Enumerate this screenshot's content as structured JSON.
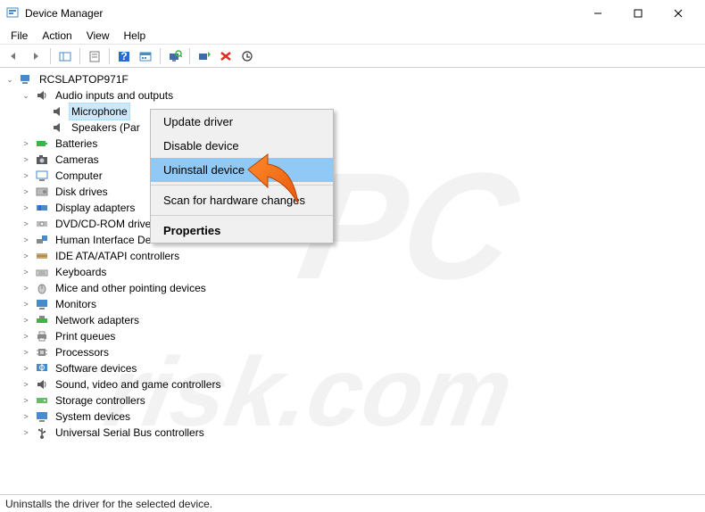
{
  "window": {
    "title": "Device Manager"
  },
  "menubar": {
    "file": "File",
    "action": "Action",
    "view": "View",
    "help": "Help"
  },
  "tree": {
    "root": "RCSLAPTOP971F",
    "audio": "Audio inputs and outputs",
    "microphone": "Microphone",
    "speakers": "Speakers (Par",
    "batteries": "Batteries",
    "cameras": "Cameras",
    "computer": "Computer",
    "diskDrives": "Disk drives",
    "displayAdapters": "Display adapters",
    "dvd": "DVD/CD-ROM drives",
    "hid": "Human Interface Devices",
    "ide": "IDE ATA/ATAPI controllers",
    "keyboards": "Keyboards",
    "mice": "Mice and other pointing devices",
    "monitors": "Monitors",
    "network": "Network adapters",
    "printQueues": "Print queues",
    "processors": "Processors",
    "software": "Software devices",
    "sound": "Sound, video and game controllers",
    "storage": "Storage controllers",
    "system": "System devices",
    "usb": "Universal Serial Bus controllers"
  },
  "contextMenu": {
    "update": "Update driver",
    "disable": "Disable device",
    "uninstall": "Uninstall device",
    "scan": "Scan for hardware changes",
    "properties": "Properties"
  },
  "statusbar": {
    "text": "Uninstalls the driver for the selected device."
  }
}
